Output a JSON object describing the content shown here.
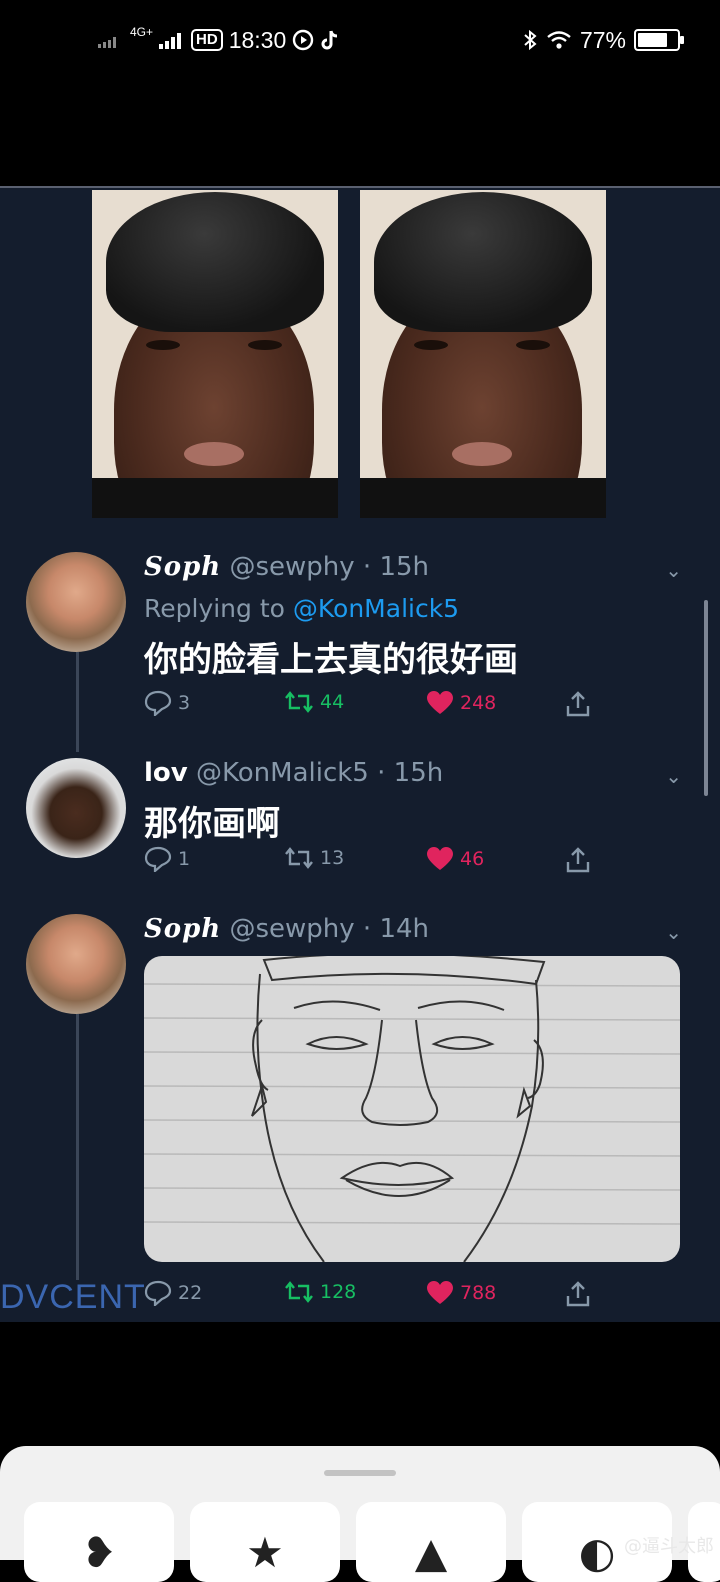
{
  "status_bar": {
    "network": "4G+",
    "hd_label": "HD",
    "time": "18:30",
    "battery_percent": "77%",
    "battery_level": 0.77,
    "icons": [
      "signal-icon",
      "hd-voice-icon",
      "play-icon",
      "tiktok-icon",
      "bluetooth-icon",
      "wifi-icon",
      "battery-icon"
    ]
  },
  "tweets": [
    {
      "name": "Soph",
      "handle": "@sewphy",
      "time": "· 15h",
      "replying_prefix": "Replying to ",
      "replying_to": "@KonMalick5",
      "text": "你的脸看上去真的很好画",
      "replies": "3",
      "retweets": "44",
      "likes": "248"
    },
    {
      "name": "lov",
      "handle": "@KonMalick5",
      "time": "· 15h",
      "text": "那你画啊",
      "replies": "1",
      "retweets": "13",
      "likes": "46"
    },
    {
      "name": "Soph",
      "handle": "@sewphy",
      "time": "· 14h",
      "replies": "22",
      "retweets": "128",
      "likes": "788"
    }
  ],
  "watermark": "DVCENT",
  "weibo_watermark": "@逼斗太郎",
  "colors": {
    "tweet_bg": "#141d2d",
    "retweet": "#17bf63",
    "like": "#e0245e",
    "mention": "#1d9bf0",
    "muted": "#8899aa"
  },
  "share_sheet": {
    "icons": [
      "heart-broken-icon",
      "star-icon",
      "pin-icon",
      "more-icon"
    ]
  }
}
